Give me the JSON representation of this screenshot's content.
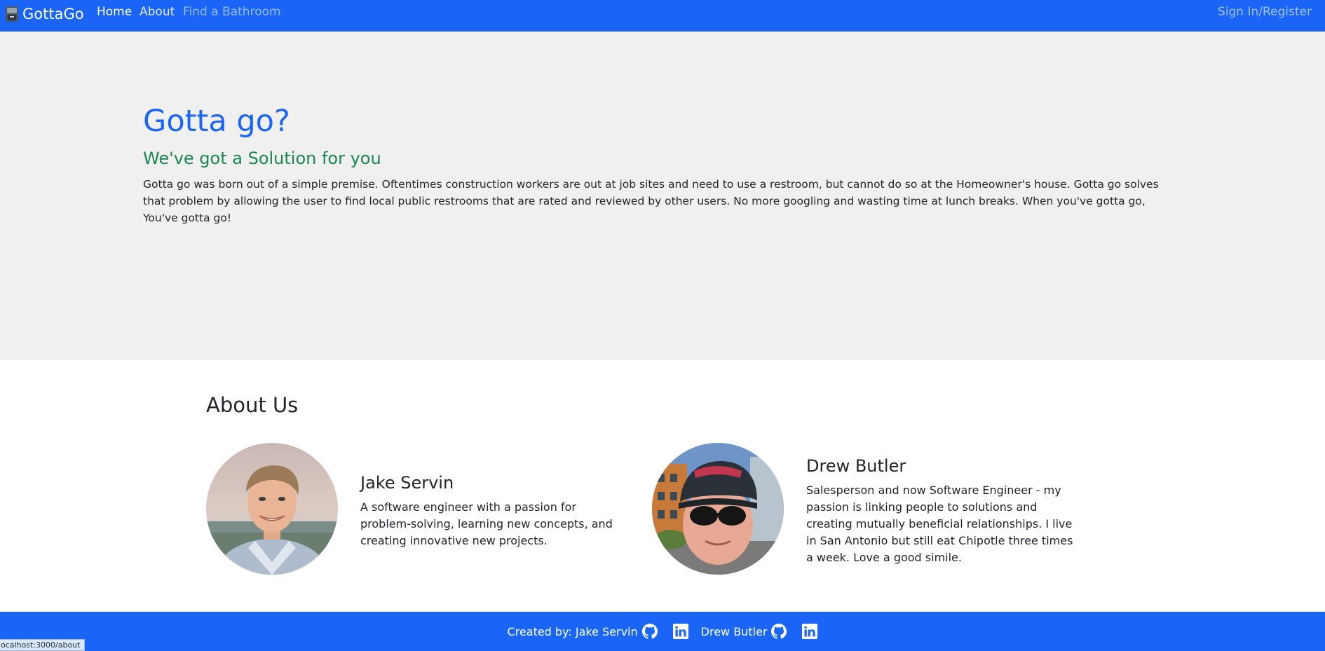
{
  "nav": {
    "brand": "GottaGo",
    "brand_icon": "toilet-icon",
    "links": [
      "Home",
      "About",
      "Find a Bathroom"
    ],
    "sign_in": "Sign In/Register"
  },
  "hero": {
    "title": "Gotta go?",
    "subtitle": "We've got a Solution for you",
    "text": "Gotta go was born out of a simple premise. Oftentimes construction workers are out at job sites and need to use a restroom, but cannot do so at the Homeowner's house. Gotta go solves that problem by allowing the user to find local public restrooms that are rated and reviewed by other users. No more googling and wasting time at lunch breaks. When you've gotta go, You've gotta go!"
  },
  "about": {
    "title": "About Us",
    "members": [
      {
        "name": "Jake Servin",
        "bio": "A software engineer with a passion for problem-solving, learning new concepts, and creating innovative new projects."
      },
      {
        "name": "Drew Butler",
        "bio": "Salesperson and now Software Engineer - my passion is linking people to solutions and creating mutually beneficial relationships. I live in San Antonio but still eat Chipotle three times a week. Love a good simile."
      }
    ]
  },
  "footer": {
    "created_by": "Created by: Jake Servin",
    "second_name": "Drew Butler",
    "icons": [
      "github-icon",
      "linkedin-icon"
    ]
  },
  "status_bar": {
    "url": "ocalhost:3000/about"
  },
  "colors": {
    "primary": "#1a65f5",
    "hero_bg": "#f0f0f0",
    "subtitle_green": "#198754"
  }
}
